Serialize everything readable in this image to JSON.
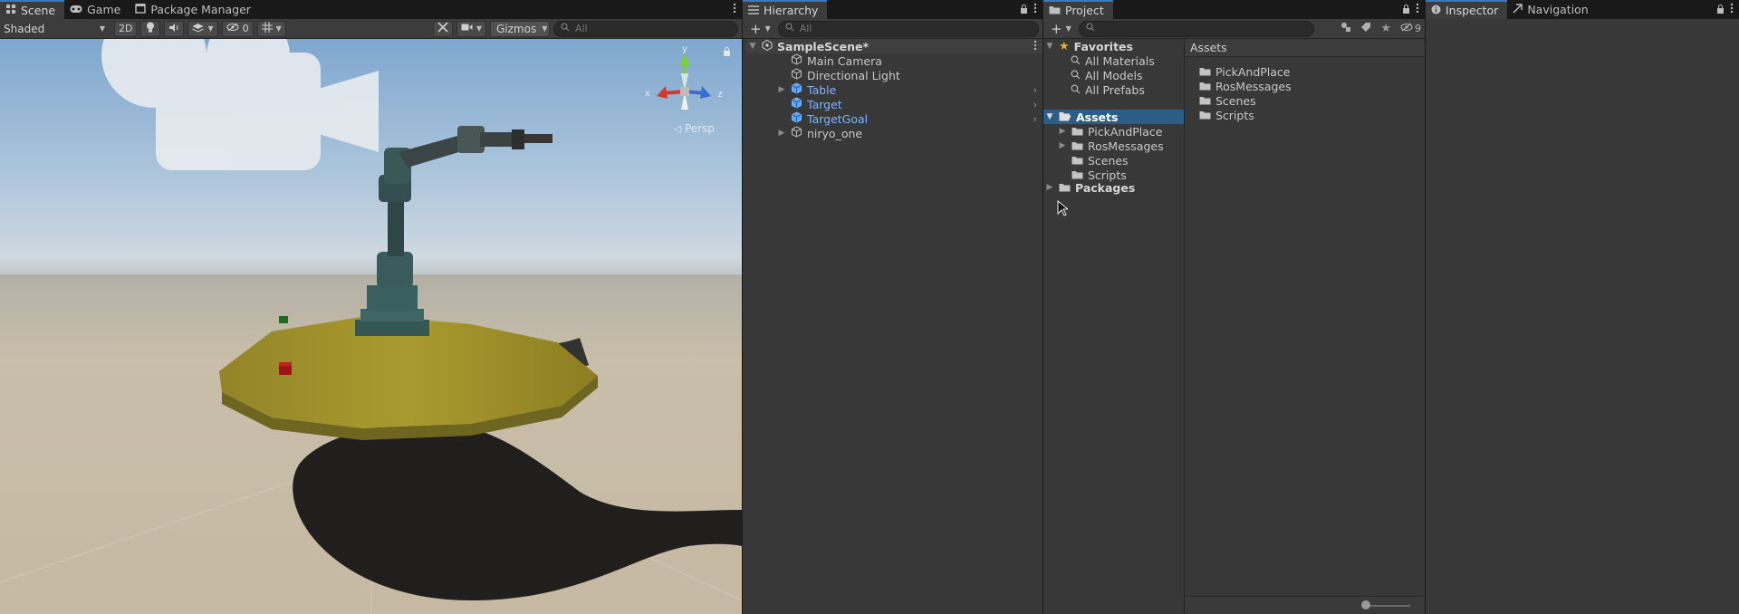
{
  "scene_panel": {
    "tabs": [
      {
        "label": "Scene",
        "icon": "grid-icon"
      },
      {
        "label": "Game",
        "icon": "gamepad-icon"
      },
      {
        "label": "Package Manager",
        "icon": "package-icon"
      }
    ],
    "toolbar": {
      "shading_mode": "Shaded",
      "mode_2d_label": "2D",
      "hidden_count": "0",
      "gizmos_label": "Gizmos",
      "search_placeholder": "All"
    },
    "view": {
      "perspective_label": "Persp",
      "axis_labels": {
        "x": "x",
        "y": "y",
        "z": "z"
      }
    }
  },
  "hierarchy": {
    "tab_label": "Hierarchy",
    "search_placeholder": "All",
    "scene_name": "SampleScene*",
    "items": [
      {
        "label": "Main Camera",
        "color": "#c8c8c8",
        "has_arrow": false,
        "prefab": false
      },
      {
        "label": "Directional Light",
        "color": "#c8c8c8",
        "has_arrow": false,
        "prefab": false
      },
      {
        "label": "Table",
        "color": "#7cb4ff",
        "has_arrow": true,
        "prefab": true
      },
      {
        "label": "Target",
        "color": "#7cb4ff",
        "has_arrow": false,
        "prefab": true
      },
      {
        "label": "TargetGoal",
        "color": "#7cb4ff",
        "has_arrow": false,
        "prefab": true
      },
      {
        "label": "niryo_one",
        "color": "#c8c8c8",
        "has_arrow": true,
        "prefab": false
      }
    ]
  },
  "project": {
    "tab_label": "Project",
    "hidden_count": "9",
    "favorites": {
      "label": "Favorites",
      "items": [
        "All Materials",
        "All Models",
        "All Prefabs"
      ]
    },
    "tree": {
      "assets_label": "Assets",
      "assets_children": [
        "PickAndPlace",
        "RosMessages",
        "Scenes",
        "Scripts"
      ],
      "packages_label": "Packages"
    },
    "content": {
      "header": "Assets",
      "folders": [
        "PickAndPlace",
        "RosMessages",
        "Scenes",
        "Scripts"
      ]
    }
  },
  "inspector_panel": {
    "tabs": [
      {
        "label": "Inspector",
        "icon": "info-icon"
      },
      {
        "label": "Navigation",
        "icon": "navigation-icon"
      }
    ]
  },
  "colors": {
    "accent_blue": "#3a79bb",
    "selection": "#2c5d87",
    "prefab_blue": "#7cb4ff",
    "panel_bg": "#383838"
  }
}
